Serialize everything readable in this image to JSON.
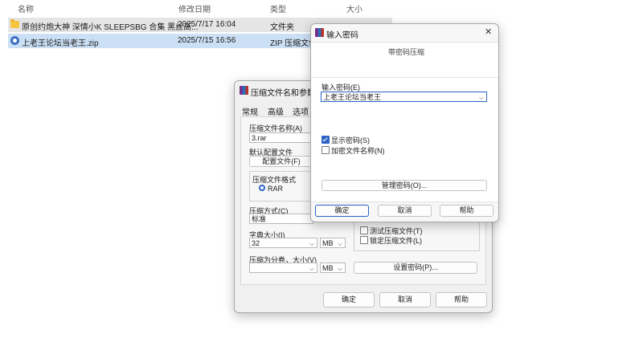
{
  "explorer": {
    "columns": {
      "name": "名称",
      "date": "修改日期",
      "type": "类型",
      "size": "大小"
    },
    "rows": [
      {
        "name": "原创约炮大神 深情小K SLEEPSBG 合集 黑丝高...",
        "date": "2025/7/17 16:04",
        "type": "文件夹",
        "icon": "folder-icon"
      },
      {
        "name": "上老王论坛当老王.zip",
        "date": "2025/7/15 16:56",
        "type": "ZIP 压缩文件",
        "icon": "zip-icon"
      }
    ]
  },
  "archive_dialog": {
    "title": "压缩文件名和参数",
    "tabs": [
      "常规",
      "高级",
      "选项"
    ],
    "filename_label": "压缩文件名称(A)",
    "filename_value": "3.rar",
    "default_profile_label": "默认配置文件",
    "profile_button": "配置文件(F)",
    "format_label": "压缩文件格式",
    "format_rar": "RAR",
    "method_label": "压缩方式(C)",
    "method_value": "标准",
    "dict_label": "字典大小(I)",
    "dict_value": "32",
    "dict_unit": "MB",
    "split_label": "压缩为分卷，大小(V)",
    "split_value": "",
    "split_unit": "MB",
    "test_archive": "测试压缩文件(T)",
    "lock_archive": "锁定压缩文件(L)",
    "set_password_button": "设置密码(P)...",
    "ok": "确定",
    "cancel": "取消",
    "help": "帮助"
  },
  "password_dialog": {
    "title": "输入密码",
    "subtitle": "带密码压缩",
    "enter_label": "输入密码(E)",
    "password_value": "上老王论坛当老王",
    "show_password": "显示密码(S)",
    "show_password_checked": true,
    "encrypt_names": "加密文件名称(N)",
    "encrypt_names_checked": false,
    "manage_button": "管理密码(O)...",
    "ok": "确定",
    "cancel": "取消",
    "help": "帮助",
    "close_glyph": "✕"
  }
}
